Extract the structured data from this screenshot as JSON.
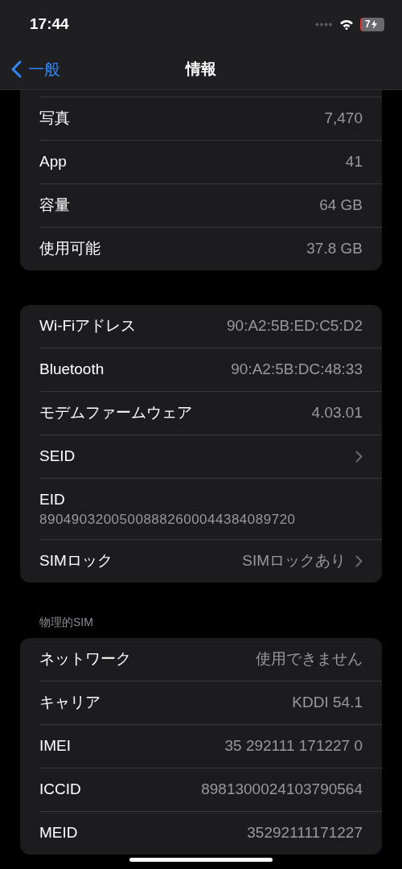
{
  "status_bar": {
    "time": "17:44",
    "battery": "7",
    "charging": true
  },
  "nav": {
    "back": "一般",
    "title": "情報"
  },
  "groups": [
    {
      "rows": [
        {
          "kind": "value",
          "label": "写真",
          "value": "7,470"
        },
        {
          "kind": "value",
          "label": "App",
          "value": "41"
        },
        {
          "kind": "value",
          "label": "容量",
          "value": "64 GB"
        },
        {
          "kind": "value",
          "label": "使用可能",
          "value": "37.8 GB"
        }
      ]
    },
    {
      "rows": [
        {
          "kind": "value",
          "label": "Wi-Fiアドレス",
          "value": "90:A2:5B:ED:C5:D2"
        },
        {
          "kind": "value",
          "label": "Bluetooth",
          "value": "90:A2:5B:DC:48:33"
        },
        {
          "kind": "value",
          "label": "モデムファームウェア",
          "value": "4.03.01"
        },
        {
          "kind": "link",
          "label": "SEID"
        },
        {
          "kind": "stacked",
          "label": "EID",
          "value": "89049032005008882600044384089720"
        },
        {
          "kind": "link",
          "label": "SIMロック",
          "value": "SIMロックあり"
        }
      ]
    },
    {
      "header": "物理的SIM",
      "rows": [
        {
          "kind": "value",
          "label": "ネットワーク",
          "value": "使用できません"
        },
        {
          "kind": "value",
          "label": "キャリア",
          "value": "KDDI 54.1"
        },
        {
          "kind": "value",
          "label": "IMEI",
          "value": "35 292111 171227 0"
        },
        {
          "kind": "value",
          "label": "ICCID",
          "value": "8981300024103790564"
        },
        {
          "kind": "value",
          "label": "MEID",
          "value": "35292111171227"
        }
      ]
    }
  ]
}
